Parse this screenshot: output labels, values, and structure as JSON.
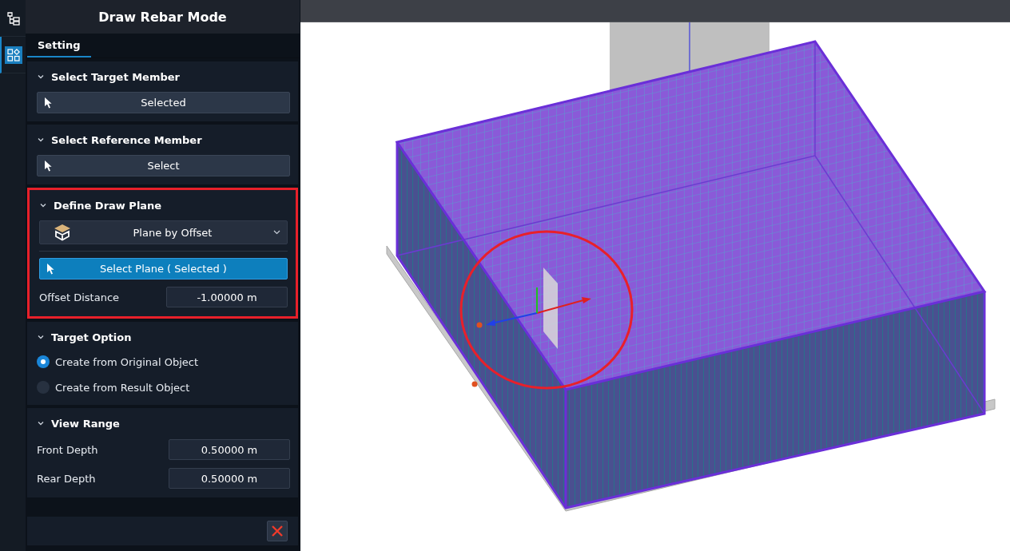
{
  "rail": {
    "items": [
      {
        "kind": "tree",
        "selected": false
      },
      {
        "kind": "widgets",
        "selected": true
      }
    ]
  },
  "panel": {
    "title": "Draw Rebar Mode",
    "tabs": [
      {
        "label": "Setting",
        "selected": true
      }
    ]
  },
  "sections": [
    {
      "title": "Select Target Member",
      "expanded": true,
      "highlighted": false,
      "items": [
        {
          "kind": "pick",
          "label": "Selected",
          "active": false
        }
      ]
    },
    {
      "title": "Select Reference Member",
      "expanded": true,
      "highlighted": false,
      "items": [
        {
          "kind": "pick",
          "label": "Select",
          "active": false
        }
      ]
    },
    {
      "title": "Define Draw Plane",
      "expanded": true,
      "highlighted": true,
      "items": [
        {
          "kind": "dropdown",
          "value": "Plane by Offset"
        },
        {
          "kind": "divider"
        },
        {
          "kind": "pick",
          "label": "Select Plane ( Selected )",
          "active": true
        },
        {
          "kind": "field",
          "label": "Offset Distance",
          "value": "-1.00000 m"
        }
      ]
    },
    {
      "title": "Target Option",
      "expanded": true,
      "highlighted": false,
      "items": [
        {
          "kind": "radio",
          "label": "Create from Original Object",
          "selected": true
        },
        {
          "kind": "radio",
          "label": "Create from Result Object",
          "selected": false
        }
      ]
    },
    {
      "title": "View Range",
      "expanded": true,
      "highlighted": false,
      "items": [
        {
          "kind": "field",
          "label": "Front Depth",
          "value": "0.50000 m"
        },
        {
          "kind": "field",
          "label": "Rear Depth",
          "value": "0.50000 m"
        }
      ]
    }
  ],
  "viewport": {
    "annotation_circle": true
  }
}
